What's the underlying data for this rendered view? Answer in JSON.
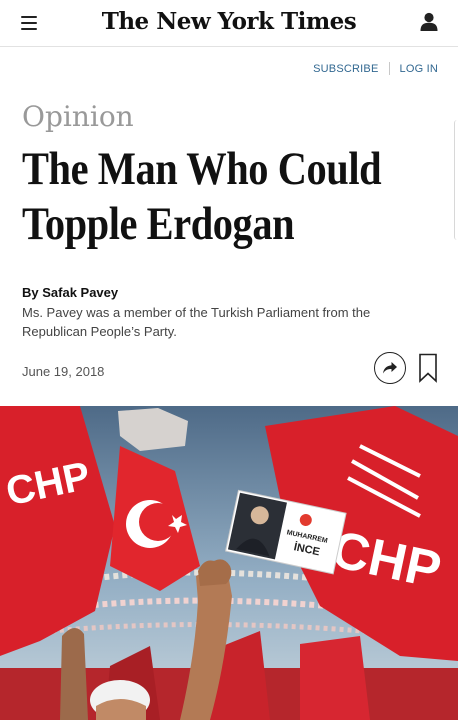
{
  "header": {
    "logo": "The New York Times",
    "menu_icon": "hamburger-menu-icon",
    "user_icon": "user-account-icon"
  },
  "account": {
    "subscribe": "SUBSCRIBE",
    "login": "LOG IN"
  },
  "article": {
    "section": "Opinion",
    "headline_line1": "The Man Who Could",
    "headline_line2": "Topple Erdogan",
    "byline": "By Safak Pavey",
    "bio": "Ms. Pavey was a member of the Turkish Parliament from the Republican People’s Party.",
    "date": "June 19, 2018"
  },
  "actions": {
    "share_icon": "share-arrow-icon",
    "save_icon": "bookmark-icon"
  },
  "photo": {
    "flag_text": "CHP",
    "placard_name_top": "MUHARREM",
    "placard_name_bottom": "İNCE"
  },
  "colors": {
    "link": "#326891",
    "section": "#999999",
    "flag_red": "#d8202a"
  }
}
